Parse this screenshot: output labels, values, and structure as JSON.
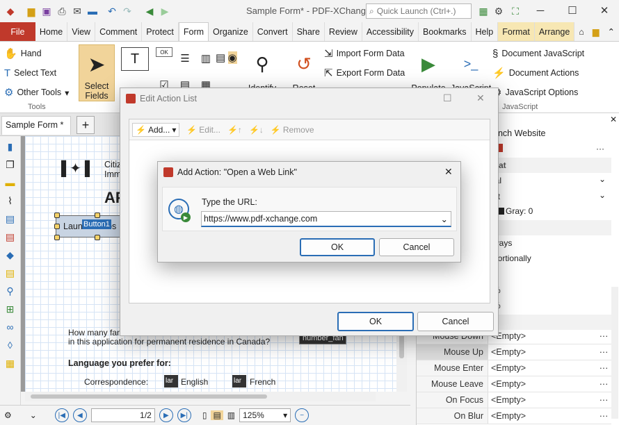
{
  "window": {
    "title": "Sample Form* - PDF-XChange ...",
    "quick_launch": "Quick Launch (Ctrl+.)",
    "minimize": "─",
    "maximize": "☐",
    "close": "✕"
  },
  "tabs": [
    "File",
    "Home",
    "View",
    "Comment",
    "Protect",
    "Form",
    "Organize",
    "Convert",
    "Share",
    "Review",
    "Accessibility",
    "Bookmarks",
    "Help",
    "Format",
    "Arrange"
  ],
  "active_tab": "Form",
  "ribbon": {
    "tools_group": {
      "label": "Tools",
      "hand": "Hand",
      "select_text": "Select Text",
      "other_tools": "Other Tools"
    },
    "select_fields": {
      "line1": "Select",
      "line2": "Fields"
    },
    "text_field": "Text",
    "identify": "Identify",
    "reset": "Reset",
    "populate": "Populate",
    "javascript": "JavaScript",
    "import_form": "Import Form Data",
    "export_form": "Export Form Data",
    "doc_js": "Document JavaScript",
    "doc_actions": "Document Actions",
    "js_options": "JavaScript Options",
    "js_group": "JavaScript"
  },
  "doc_tab": "Sample Form *",
  "document": {
    "citiz": "Citiz",
    "imm": "Imm",
    "ap": "AP",
    "button_label": "Button1",
    "launch": "Launch Webs",
    "question1": "How many fan",
    "question2": "in this application for permanent residence in Canada?",
    "number_field": "number_fan",
    "language": "Language you prefer for:",
    "correspondence": "Correspondence:",
    "english": "English",
    "french": "French",
    "lan": "lar"
  },
  "props": {
    "launch_website": "unch Website",
    "ial": "ial",
    "pt": "pt",
    "gray": "Gray: 0",
    "ways": "ways",
    "proportionally": "portionally",
    "p": "p",
    "pct1": "%",
    "pct2": "%",
    "mouse_down": "Mouse Down",
    "mouse_up": "Mouse Up",
    "mouse_enter": "Mouse Enter",
    "mouse_leave": "Mouse Leave",
    "on_focus": "On Focus",
    "on_blur": "On Blur",
    "empty": "<Empty>",
    "ellipsis": "···",
    "at": "at"
  },
  "status": {
    "page": "1",
    "pages": "/2",
    "zoom": "125%"
  },
  "edit_action_list": {
    "title": "Edit Action List",
    "add": "Add...",
    "edit": "Edit...",
    "remove": "Remove",
    "ok": "OK",
    "cancel": "Cancel"
  },
  "add_action": {
    "title": "Add Action: \"Open a Web Link\"",
    "prompt": "Type the URL:",
    "url": "https://www.pdf-xchange.com",
    "ok": "OK",
    "cancel": "Cancel"
  }
}
